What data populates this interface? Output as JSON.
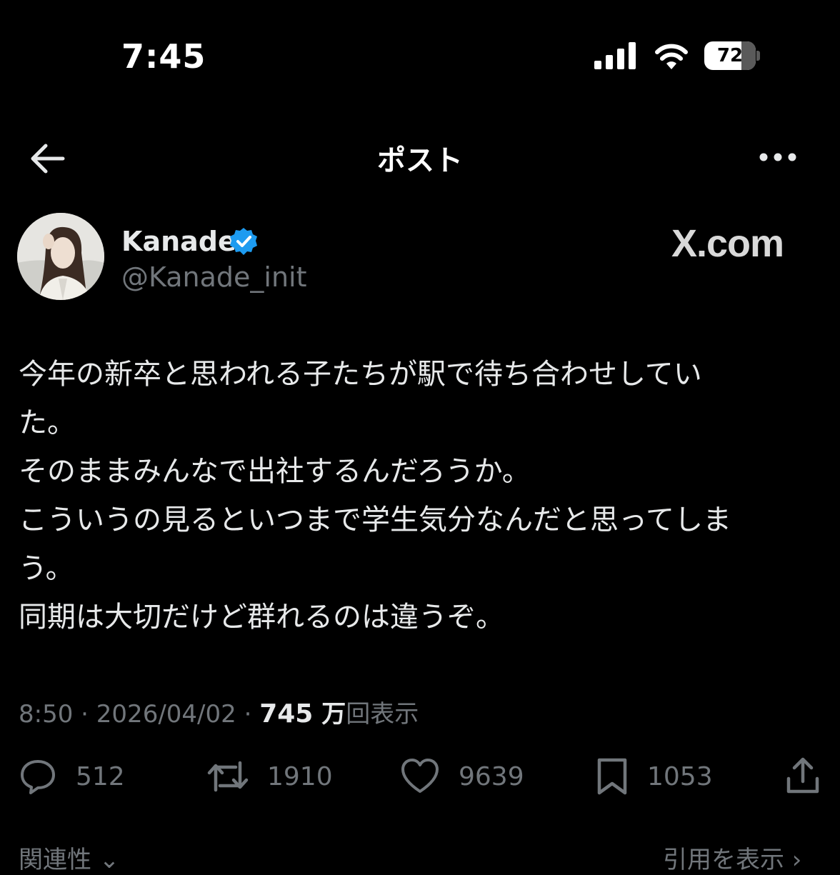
{
  "status_bar": {
    "time": "7:45",
    "battery": "72",
    "battery_level": 0.72,
    "icons": [
      "cellular-signal-icon",
      "wifi-icon",
      "battery-icon"
    ]
  },
  "header": {
    "title": "ポスト",
    "back_icon": "arrow-left-icon",
    "more_icon": "more-horizontal-icon"
  },
  "author": {
    "name": "Kanade",
    "handle": "@Kanade_init",
    "verified": true,
    "verified_color": "#1d9bf0"
  },
  "watermark": "X.com",
  "post": {
    "text": "今年の新卒と思われる子たちが駅で待ち合わせしてい\nた。\nそのままみんなで出社するんだろうか。\nこういうの見るといつまで学生気分なんだと思ってしま\nう。\n同期は大切だけど群れるのは違うぞ。"
  },
  "meta": {
    "time": "8:50",
    "separator": "·",
    "date": "2026/04/02",
    "views_number": "745",
    "views_unit": "万",
    "views_label": "回表示"
  },
  "actions": {
    "replies": "512",
    "reposts": "1910",
    "likes": "9639",
    "bookmarks": "1053"
  },
  "footer": {
    "left": "関連性 ⌄",
    "right": "引用を表示 ›"
  },
  "colors": {
    "background": "#000000",
    "text": "#e7e9ea",
    "secondary": "#71767b"
  }
}
